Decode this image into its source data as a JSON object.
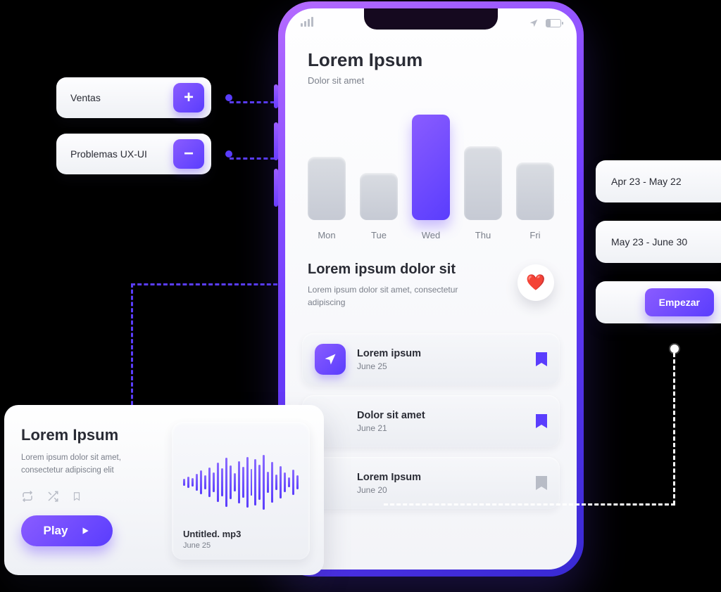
{
  "header": {
    "title": "Lorem Ipsum",
    "subtitle": "Dolor sit amet"
  },
  "chart_data": {
    "type": "bar",
    "categories": [
      "Mon",
      "Tue",
      "Wed",
      "Thu",
      "Fri"
    ],
    "values": [
      60,
      45,
      100,
      70,
      55
    ],
    "highlight_index": 2,
    "title": "",
    "xlabel": "",
    "ylabel": "",
    "ylim": [
      0,
      100
    ]
  },
  "overview": {
    "title": "Lorem ipsum dolor sit",
    "body": "Lorem ipsum dolor sit amet, consectetur adipiscing"
  },
  "list": [
    {
      "title": "Lorem ipsum",
      "date": "June 25",
      "icon": "navigate",
      "bookmark": "violet"
    },
    {
      "title": "Dolor sit amet",
      "date": "June 21",
      "icon": "",
      "bookmark": "violet"
    },
    {
      "title": "Lorem Ipsum",
      "date": "June 20",
      "icon": "",
      "bookmark": "grey"
    }
  ],
  "left_chips": [
    {
      "label": "Ventas",
      "op": "+"
    },
    {
      "label": "Problemas UX-UI",
      "op": "−"
    }
  ],
  "player": {
    "title": "Lorem Ipsum",
    "body": "Lorem ipsum dolor sit amet, consectetur adipiscing elit",
    "play_label": "Play",
    "track_title": "Untitled. mp3",
    "track_date": "June 25",
    "wave": [
      10,
      16,
      12,
      24,
      34,
      20,
      42,
      28,
      56,
      40,
      70,
      48,
      26,
      60,
      44,
      72,
      38,
      66,
      50,
      78,
      30,
      58,
      22,
      46,
      28,
      14,
      36,
      20
    ]
  },
  "right": {
    "range1": "Apr 23 - May 22",
    "range2": "May 23 - June 30",
    "cta": "Empezar"
  }
}
